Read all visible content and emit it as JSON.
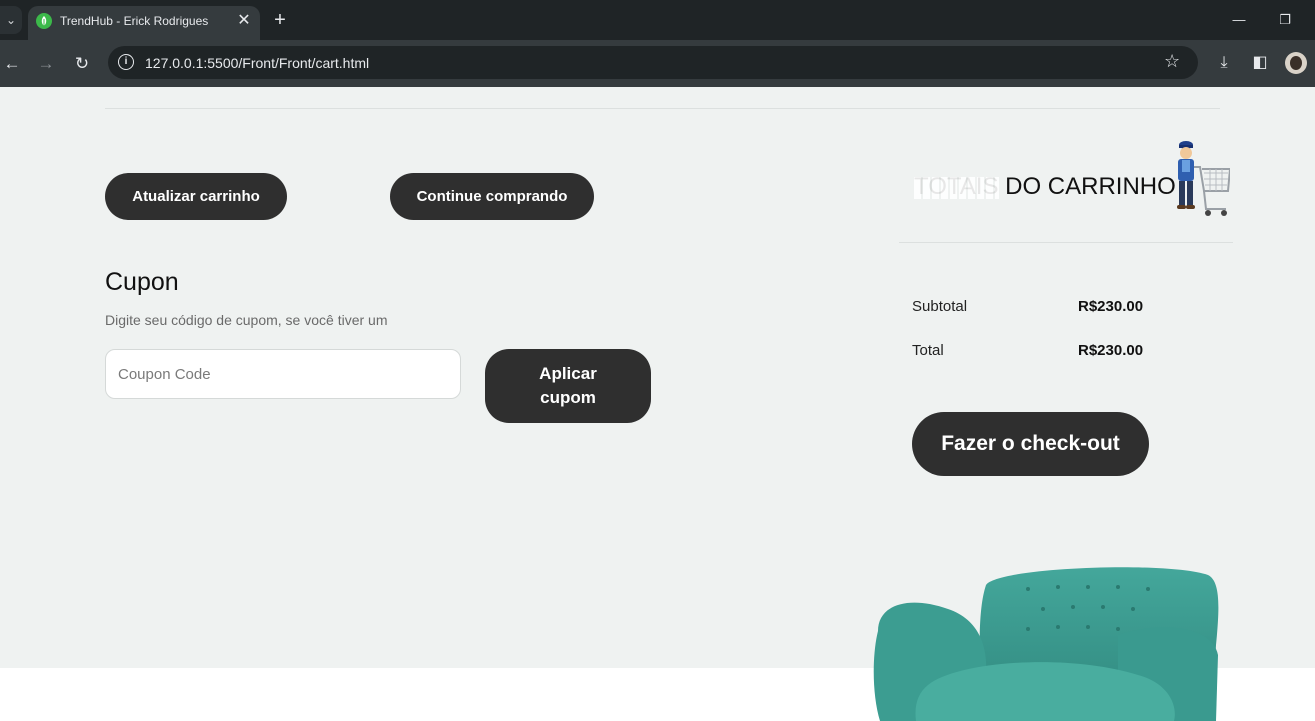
{
  "browser": {
    "tab_title": "TrendHub - Erick Rodrigues",
    "tab_close": "✕",
    "new_tab": "+",
    "url": "127.0.0.1:5500/Front/Front/cart.html",
    "minimize": "—",
    "restore": "❐",
    "back": "←",
    "forward": "→",
    "reload": "↻",
    "bookmark_star": "☆",
    "download_icon": "⤓",
    "sidepanel_icon": "◧",
    "tab_search": "⌄"
  },
  "cart": {
    "update_button": "Atualizar carrinho",
    "continue_button": "Continue comprando"
  },
  "coupon": {
    "title": "Cupon",
    "description": "Digite seu código de cupom, se você tiver um",
    "placeholder": "Coupon Code",
    "apply_button": "Aplicar cupom"
  },
  "totals": {
    "title": "TOTAIS DO CARRINHO",
    "rows": [
      {
        "label": "Subtotal",
        "value": "R$230.00"
      },
      {
        "label": "Total",
        "value": "R$230.00"
      }
    ],
    "checkout_button": "Fazer o check-out"
  },
  "colors": {
    "page_bg": "#eff2f1",
    "button_dark": "#2f2f2f",
    "chair": "#3a9a8f"
  }
}
